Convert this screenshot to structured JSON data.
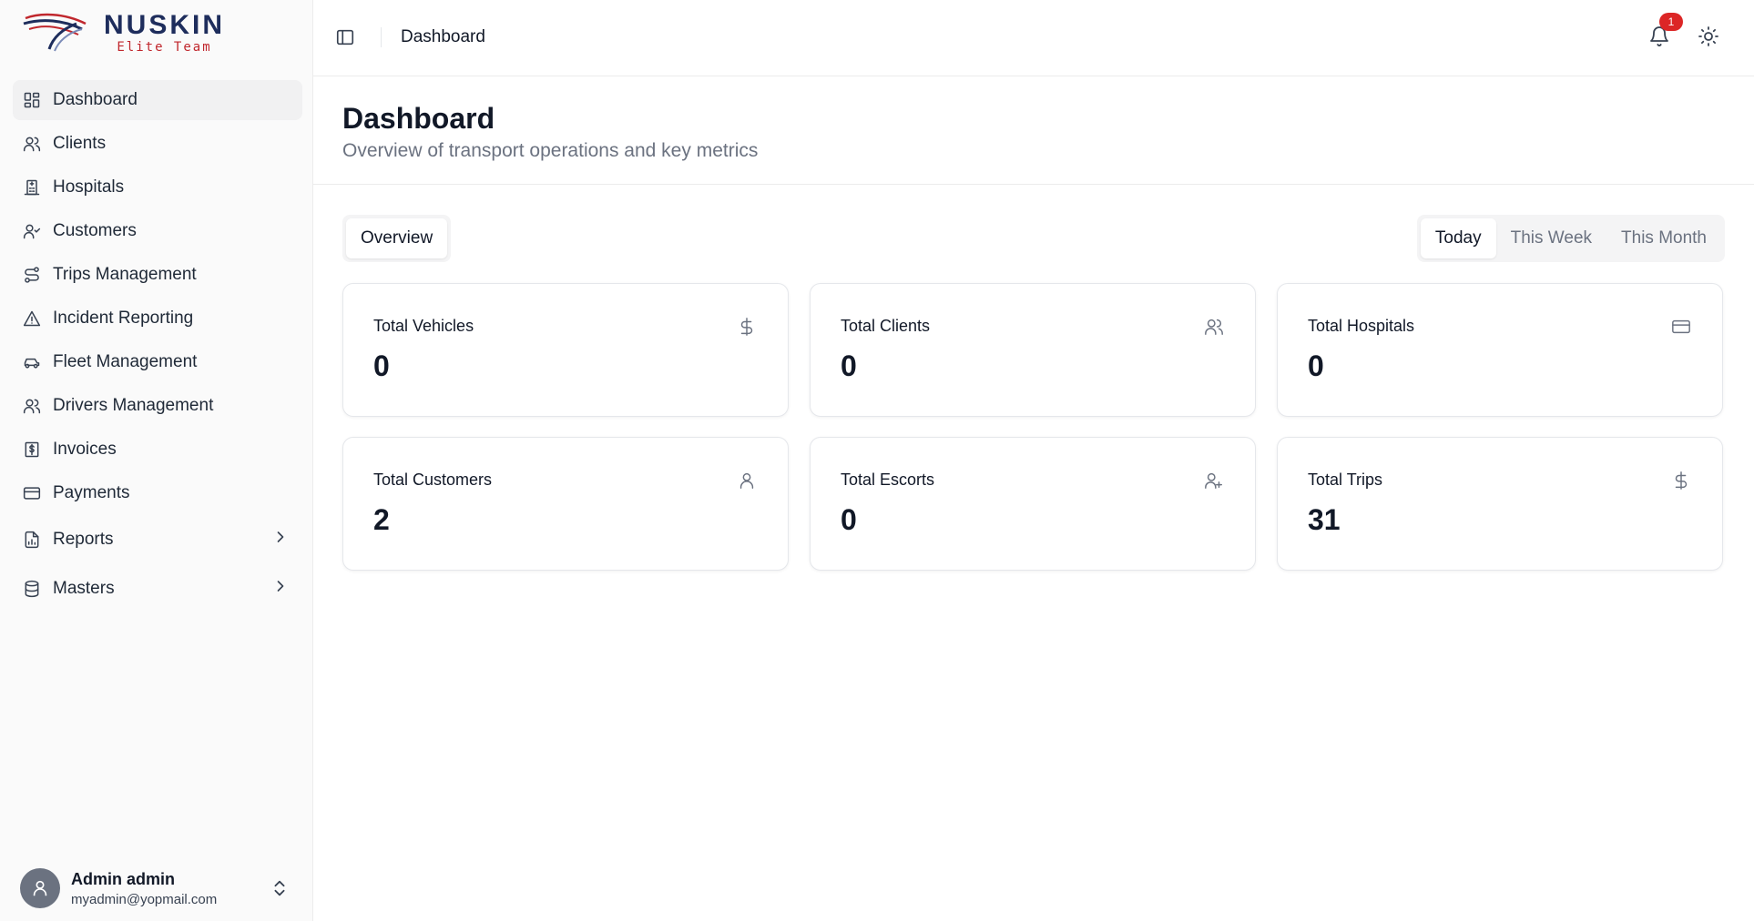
{
  "brand": {
    "name": "NUSKIN",
    "tagline": "Elite Team"
  },
  "sidebar": {
    "items": [
      {
        "label": "Dashboard",
        "icon": "dashboard-grid-icon",
        "active": true
      },
      {
        "label": "Clients",
        "icon": "users-icon"
      },
      {
        "label": "Hospitals",
        "icon": "hospital-building-icon"
      },
      {
        "label": "Customers",
        "icon": "user-check-icon"
      },
      {
        "label": "Trips Management",
        "icon": "route-icon"
      },
      {
        "label": "Incident Reporting",
        "icon": "alert-triangle-icon"
      },
      {
        "label": "Fleet Management",
        "icon": "car-icon"
      },
      {
        "label": "Drivers Management",
        "icon": "users-icon"
      },
      {
        "label": "Invoices",
        "icon": "receipt-dollar-icon"
      },
      {
        "label": "Payments",
        "icon": "credit-card-icon"
      },
      {
        "label": "Reports",
        "icon": "file-chart-icon",
        "expandable": true
      },
      {
        "label": "Masters",
        "icon": "database-icon",
        "expandable": true
      }
    ]
  },
  "user": {
    "name": "Admin admin",
    "email": "myadmin@yopmail.com"
  },
  "topbar": {
    "breadcrumb": "Dashboard",
    "notifications_count": "1"
  },
  "page": {
    "title": "Dashboard",
    "subtitle": "Overview of transport operations and key metrics"
  },
  "tabs": {
    "overview_label": "Overview"
  },
  "range": {
    "options": [
      "Today",
      "This Week",
      "This Month"
    ],
    "selected": "Today"
  },
  "stats": [
    {
      "label": "Total Vehicles",
      "value": "0",
      "icon": "dollar-icon"
    },
    {
      "label": "Total Clients",
      "value": "0",
      "icon": "users-icon"
    },
    {
      "label": "Total Hospitals",
      "value": "0",
      "icon": "credit-card-icon"
    },
    {
      "label": "Total Customers",
      "value": "2",
      "icon": "user-icon"
    },
    {
      "label": "Total Escorts",
      "value": "0",
      "icon": "user-plus-icon"
    },
    {
      "label": "Total Trips",
      "value": "31",
      "icon": "dollar-icon"
    }
  ],
  "colors": {
    "notification_badge": "#dc2626",
    "brand_navy": "#1e2d5c",
    "brand_red": "#c0272d"
  }
}
